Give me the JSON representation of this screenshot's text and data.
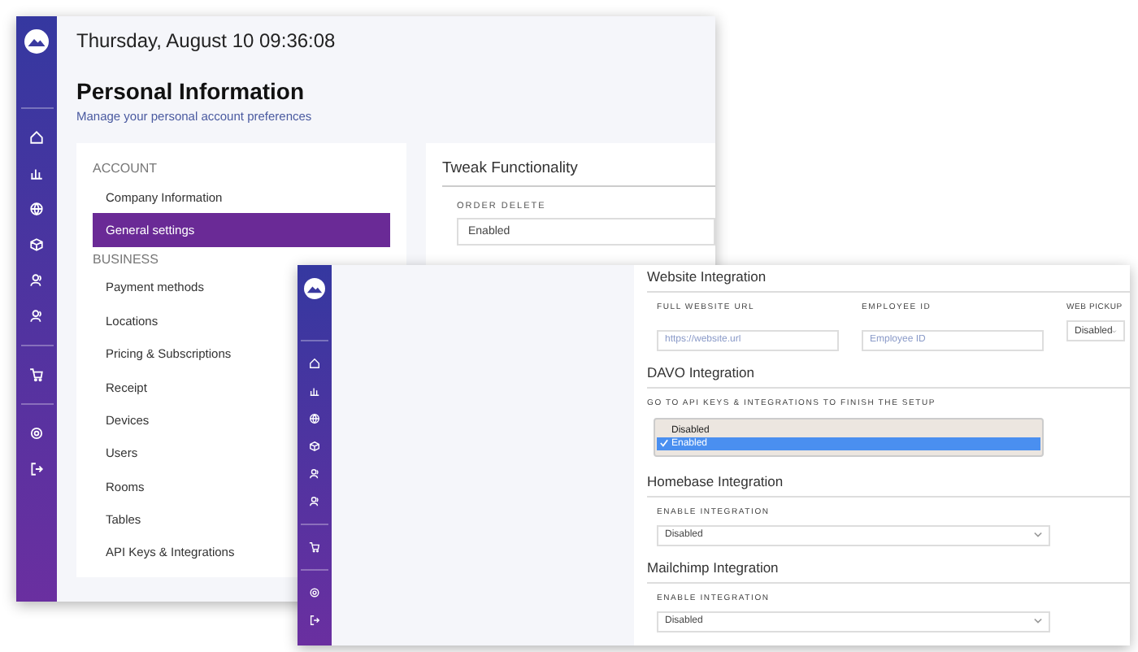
{
  "back_window": {
    "date": "Thursday, August 10 09:36:08",
    "title": "Personal Information",
    "subtitle": "Manage your personal account preferences",
    "menu": [
      {
        "heading": "ACCOUNT",
        "items": [
          {
            "label": "Company Information",
            "selected": false
          },
          {
            "label": "General settings",
            "selected": true
          }
        ]
      },
      {
        "heading": "BUSINESS",
        "items": [
          {
            "label": "Payment methods",
            "selected": false
          },
          {
            "label": "Locations",
            "selected": false
          },
          {
            "label": "Pricing & Subscriptions",
            "selected": false
          },
          {
            "label": "Receipt",
            "selected": false
          },
          {
            "label": "Devices",
            "selected": false
          },
          {
            "label": "Users",
            "selected": false
          },
          {
            "label": "Rooms",
            "selected": false
          },
          {
            "label": "Tables",
            "selected": false
          },
          {
            "label": "API Keys & Integrations",
            "selected": false
          }
        ]
      }
    ],
    "panel": {
      "title": "Tweak Functionality",
      "field": {
        "label": "ORDER DELETE",
        "value": "Enabled"
      }
    }
  },
  "front_window": {
    "sections": [
      {
        "title": "Website Integration",
        "fields": [
          {
            "kind": "text",
            "label": "FULL WEBSITE URL",
            "placeholder": "https://website.url"
          },
          {
            "kind": "text",
            "label": "EMPLOYEE ID",
            "placeholder": "Employee ID"
          },
          {
            "kind": "select",
            "label": "WEB PICKUP",
            "value": "Disabled"
          }
        ]
      },
      {
        "title": "DAVO Integration",
        "note": "GO TO API KEYS & INTEGRATIONS TO FINISH THE SETUP",
        "dropdown": [
          {
            "label": "Disabled",
            "selected": false
          },
          {
            "label": "Enabled",
            "selected": true
          }
        ]
      },
      {
        "title": "Homebase Integration",
        "fields": [
          {
            "kind": "select",
            "label": "ENABLE INTEGRATION",
            "value": "Disabled"
          }
        ]
      },
      {
        "title": "Mailchimp Integration",
        "fields": [
          {
            "kind": "select",
            "label": "ENABLE INTEGRATION",
            "value": "Disabled"
          }
        ]
      }
    ]
  }
}
